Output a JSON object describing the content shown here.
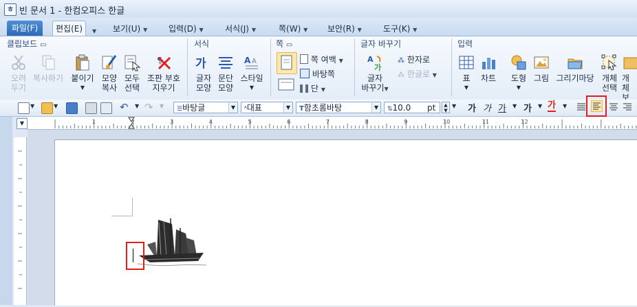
{
  "window": {
    "title": "빈 문서 1 - 한컴오피스 한글"
  },
  "menu": {
    "file": "파일(F)",
    "tabs": [
      "편집(E)",
      "보기(U)",
      "입력(D)",
      "서식(J)",
      "쪽(W)",
      "보안(R)",
      "도구(K)"
    ]
  },
  "ribbon": {
    "groups": {
      "clipboard": "클립보드",
      "format": "서식",
      "page": "쪽",
      "replace": "글자 바꾸기",
      "input": "입력"
    },
    "clipboard": {
      "cut": [
        "오려",
        "두기"
      ],
      "copy": "복사하기",
      "paste": "붙이기",
      "format_copy": [
        "모양",
        "복사"
      ],
      "select_all": [
        "모두",
        "선택"
      ],
      "erase_combo": [
        "조판 부호",
        "지우기"
      ]
    },
    "format": {
      "char_shape": [
        "글자",
        "모양"
      ],
      "para_shape": [
        "문단",
        "모양"
      ],
      "style": "스타일"
    },
    "page": {
      "margin": "쪽 여백",
      "master": "바탕쪽",
      "column": "단"
    },
    "replace": {
      "char_replace": [
        "글자",
        "바꾸기"
      ],
      "to_hanja": "한자로",
      "to_hangul": "한글로"
    },
    "input": {
      "table": "표",
      "chart": "차트",
      "shape": "도형",
      "picture": "그림",
      "drawing_mart": "그리기마당",
      "object_select": [
        "개체",
        "선택"
      ],
      "object_protect": [
        "개체",
        "보호"
      ]
    }
  },
  "toolbar": {
    "style": "바탕글",
    "lang": "대표",
    "font": "함초롬바탕",
    "size": "10.0",
    "unit": "pt",
    "bold": "가",
    "italic": "가",
    "underline": "가",
    "strike": "가",
    "color": "가"
  },
  "ruler": {
    "numbers": [
      "1",
      "2",
      "3",
      "4",
      "5",
      "6",
      "7",
      "8",
      "9",
      "10",
      "11",
      "12"
    ]
  },
  "colors": {
    "highlight": "#e21b1b",
    "accent": "#2e6bb8"
  }
}
